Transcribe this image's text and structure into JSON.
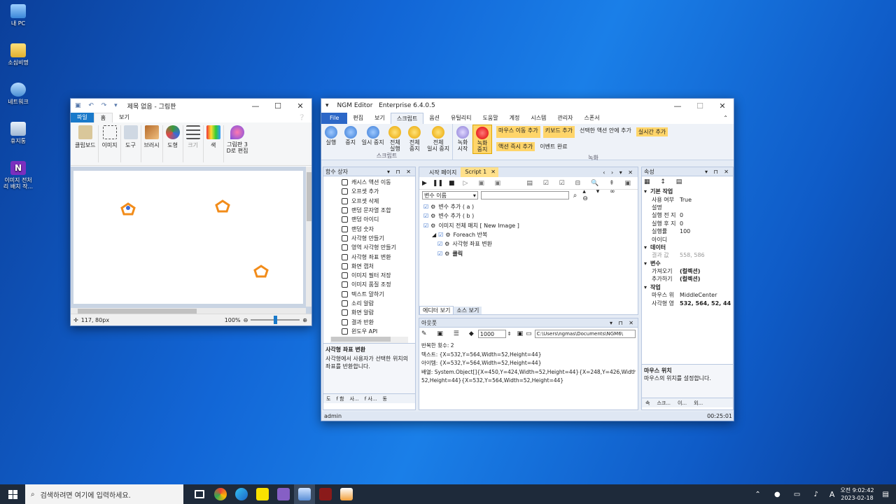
{
  "desktop": {
    "icons": [
      {
        "label": "내 PC"
      },
      {
        "label": "소심비명"
      },
      {
        "label": "네트워크"
      },
      {
        "label": "휴지통"
      },
      {
        "label": "이미지 전처\n리 배치 작..."
      }
    ]
  },
  "paint": {
    "title": "제목 없음 - 그림판",
    "tabs": [
      "파일",
      "홈",
      "보기"
    ],
    "ribbon": [
      "클립보드",
      "이미지",
      "도구",
      "브러시",
      "도형",
      "크기",
      "색",
      "그림판 3\nD로 편집"
    ],
    "status_pos": "117, 80px",
    "zoom": "100%",
    "shape_color": "#f28c1a"
  },
  "ngm": {
    "title": "NGM Editor   Enterprise 6.4.0.5",
    "menu": [
      "File",
      "편집",
      "보기",
      "스크립트",
      "옵션",
      "유틸리티",
      "도움말",
      "계정",
      "시스템",
      "관리자",
      "스폰서"
    ],
    "ribbon_script": {
      "buttons": [
        "실행",
        "중지",
        "일시 중지",
        "전체\n실행",
        "전체\n중지",
        "전체\n일시 중지"
      ],
      "group_label": "스크립트"
    },
    "ribbon_record": {
      "buttons": [
        "녹화\n시작",
        "녹화\n중지"
      ],
      "actions": [
        "마우스 이동 추가",
        "키보드 추가",
        "선택한 액션 안에 추가",
        "실시간 추가",
        "액션 즉시 추가",
        "이벤트 완료"
      ],
      "group_label": "녹화"
    },
    "function_box": {
      "title": "함수 상자",
      "items": [
        "캐시스 액션 이동",
        "오프셋 추가",
        "오프셋 삭제",
        "랜덤 문자열 조합",
        "랜덤 아이디",
        "랜덤 숫자",
        "사각형 만들기",
        "영역 사각형 만들기",
        "사각형 좌표 변환",
        "화면 캡처",
        "이미지 필터 저장",
        "이미지 품질 조정",
        "텍스트 말하기",
        "소리 알람",
        "화면 알람",
        "결과 반환",
        "윈도우 API"
      ],
      "desc_title": "사각형 좌표 변환",
      "desc_text": "사각형에서 사용자가 선택한 위치의 좌표를 반환합니다.",
      "bottom_tabs": [
        "도",
        "f 함",
        "사...",
        "f 사...",
        "동"
      ]
    },
    "editor": {
      "tabs": [
        "시작 페이지",
        "Script 1"
      ],
      "var_select": "변수 이름",
      "script_lines": [
        {
          "indent": 1,
          "text": "변수 추가 ( a )"
        },
        {
          "indent": 1,
          "text": "변수 추가 ( b )"
        },
        {
          "indent": 1,
          "text": "이미지 전체 매치 [ New Image ]"
        },
        {
          "indent": 0,
          "text": "Foreach 반복"
        },
        {
          "indent": 2,
          "text": "사각형 좌표 변환"
        },
        {
          "indent": 2,
          "text": "클릭"
        }
      ],
      "bottom_tabs": [
        "에디터 보기",
        "소스 보기"
      ]
    },
    "output": {
      "title": "아웃풋",
      "count_value": "1000",
      "path": "C:\\Users\\ngmas\\Documents\\NGM6\\",
      "lines": [
        "반복한 횟수: 2",
        "텍스트: {X=532,Y=564,Width=52,Height=44}",
        "아이템: {X=532,Y=564,Width=52,Height=44}",
        "배열: System.Object[]{X=450,Y=424,Width=52,Height=44}{X=248,Y=426,Width=52,Height=44}{X=532,Y=564,Width=52,Height=44},",
        "52,Height=44}{X=532,Y=564,Width=52,Height=44}"
      ]
    },
    "properties": {
      "title": "속성",
      "categories": [
        {
          "name": "기본 작업",
          "rows": [
            [
              "사용 여부",
              "True"
            ],
            [
              "설명",
              ""
            ],
            [
              "실행 전 지",
              "0"
            ],
            [
              "실행 후 지",
              "0"
            ],
            [
              "실행률",
              "100"
            ],
            [
              "아이디",
              ""
            ]
          ]
        },
        {
          "name": "데이터",
          "rows": [
            [
              "결과 값",
              "558, 586"
            ]
          ]
        },
        {
          "name": "변수",
          "rows": [
            [
              "가져오기",
              "(컬렉션)"
            ],
            [
              "추가하기",
              "(컬렉션)"
            ]
          ]
        },
        {
          "name": "작업",
          "rows": [
            [
              "마우스 위",
              "MiddleCenter"
            ],
            [
              "사각형 영",
              "532, 564, 52, 44"
            ]
          ]
        }
      ],
      "desc_title": "마우스 위치",
      "desc_text": "마우스의 위치를 설정합니다.",
      "bottom_tabs": [
        "속",
        "스크...",
        "이...",
        "외..."
      ]
    },
    "status_user": "admin",
    "status_time": "00:25:01"
  },
  "taskbar": {
    "search_placeholder": "검색하려면 여기에 입력하세요.",
    "time": "오전 9:02:42",
    "date": "2023-02-18",
    "ime": "A"
  }
}
